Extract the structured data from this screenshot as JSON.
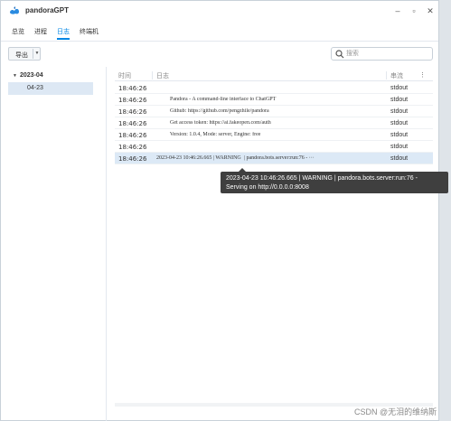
{
  "window": {
    "title": "pandoraGPT"
  },
  "tabs": [
    {
      "label": "总览",
      "active": false
    },
    {
      "label": "进程",
      "active": false
    },
    {
      "label": "日志",
      "active": true
    },
    {
      "label": "终端机",
      "active": false
    }
  ],
  "toolbar": {
    "export_label": "导出",
    "search_placeholder": "搜索"
  },
  "sidebar": {
    "group_label": "2023-04",
    "item_label": "04-23"
  },
  "table": {
    "columns": {
      "time": "时间",
      "log": "日志",
      "stream": "串流"
    },
    "rows": [
      {
        "time": "18:46:26",
        "log": "",
        "stream": "stdout"
      },
      {
        "time": "18:46:26",
        "log": "          Pandora - A command-line interface to ChatGPT",
        "stream": "stdout"
      },
      {
        "time": "18:46:26",
        "log": "          Github: https://github.com/pengzhile/pandora",
        "stream": "stdout"
      },
      {
        "time": "18:46:26",
        "log": "          Get access token: https://ai.fakeopen.com/auth",
        "stream": "stdout"
      },
      {
        "time": "18:46:26",
        "log": "          Version: 1.0.4, Mode: server, Engine: free",
        "stream": "stdout"
      },
      {
        "time": "18:46:26",
        "log": "",
        "stream": "stdout"
      },
      {
        "time": "18:46:26",
        "log": "2023-04-23 10:46:26.665 | WARNING  | pandora.bots.server:run:76 - ···",
        "stream": "stdout",
        "selected": true
      }
    ]
  },
  "tooltip": {
    "line1": "2023-04-23 10:46:26.665 | WARNING | pandora.bots.server:run:76 -",
    "line2": "Serving on http://0.0.0.0:8008"
  },
  "watermark": "CSDN @无泪的维纳斯",
  "icons": {
    "app": "cloud-bird-icon",
    "minimize": "minimize-icon",
    "maximize": "maximize-icon",
    "close": "close-icon",
    "search": "search-icon",
    "caret": "caret-down-icon",
    "more": "more-vertical-icon"
  },
  "colors": {
    "accent": "#0086e5",
    "selected_row": "#dce9f6",
    "sidebar_selected": "#dde8f4",
    "tooltip_bg": "#3f3f3f"
  }
}
